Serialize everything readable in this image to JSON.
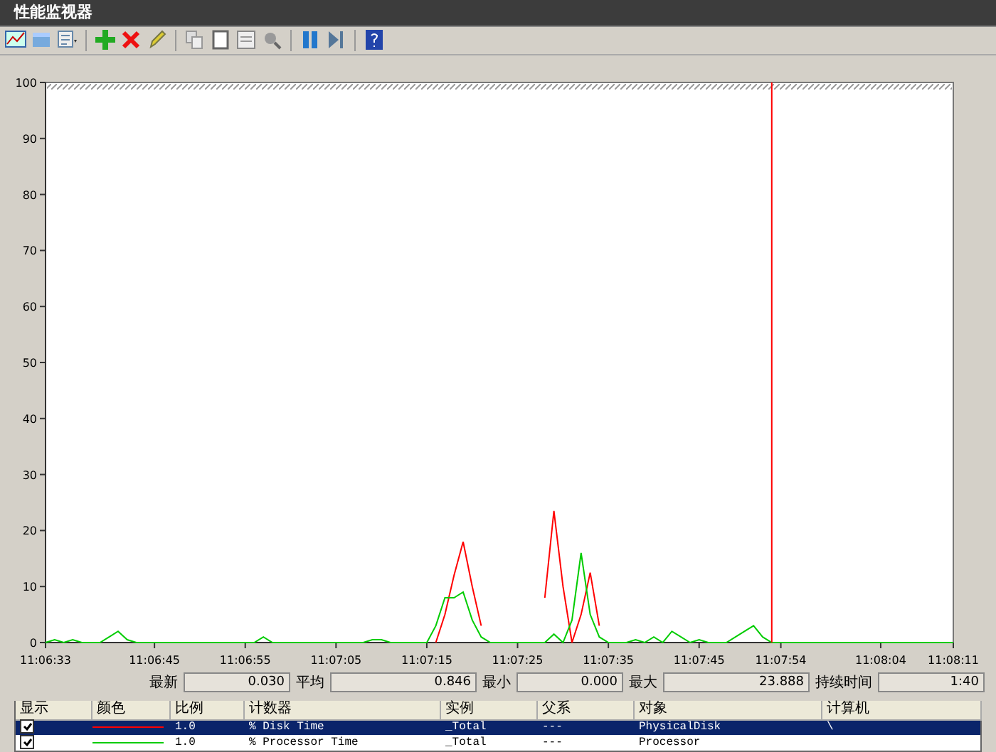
{
  "window": {
    "title": "性能监视器"
  },
  "chart": {
    "chart_data": {
      "type": "line",
      "ylim": [
        0,
        100
      ],
      "yticks": [
        0,
        10,
        20,
        30,
        40,
        50,
        60,
        70,
        80,
        90,
        100
      ],
      "categories": [
        "11:06:33",
        null,
        null,
        null,
        null,
        null,
        null,
        null,
        null,
        null,
        null,
        null,
        "11:06:45",
        null,
        null,
        null,
        null,
        null,
        null,
        null,
        null,
        null,
        "11:06:55",
        null,
        null,
        null,
        null,
        null,
        null,
        null,
        null,
        null,
        "11:07:05",
        null,
        null,
        null,
        null,
        null,
        null,
        null,
        null,
        null,
        "11:07:15",
        null,
        null,
        null,
        null,
        null,
        null,
        null,
        null,
        null,
        "11:07:25",
        null,
        null,
        null,
        null,
        null,
        null,
        null,
        null,
        null,
        "11:07:35",
        null,
        null,
        null,
        null,
        null,
        null,
        null,
        null,
        null,
        "11:07:45",
        null,
        null,
        null,
        null,
        null,
        null,
        null,
        null,
        "11:07:54",
        null,
        null,
        null,
        null,
        null,
        null,
        null,
        null,
        null,
        null,
        "11:08:04",
        null,
        null,
        null,
        null,
        null,
        null,
        null,
        "11:08:11"
      ],
      "series": [
        {
          "color": "#ff0000",
          "values": [
            null,
            null,
            null,
            null,
            null,
            null,
            null,
            null,
            null,
            null,
            null,
            null,
            null,
            null,
            null,
            null,
            null,
            null,
            null,
            null,
            null,
            null,
            null,
            null,
            null,
            null,
            null,
            null,
            null,
            null,
            null,
            null,
            null,
            null,
            null,
            null,
            null,
            null,
            null,
            null,
            null,
            null,
            null,
            0,
            5,
            12,
            18,
            10,
            3,
            null,
            null,
            null,
            null,
            null,
            null,
            8,
            23.5,
            10,
            0,
            5,
            12.5,
            3,
            null,
            null,
            null,
            null,
            null,
            null,
            null,
            null,
            null,
            null,
            null,
            null,
            null,
            null,
            null,
            null,
            null,
            null,
            null,
            null,
            null,
            null,
            null,
            null,
            null,
            null,
            null,
            null,
            null,
            null,
            null,
            null,
            null,
            null,
            null,
            null,
            null,
            null,
            null
          ]
        },
        {
          "color": "#00cc00",
          "values": [
            0,
            0.5,
            0,
            0.5,
            0,
            0,
            0,
            1,
            2,
            0.5,
            0,
            0,
            0,
            0,
            0,
            0,
            0,
            0,
            0,
            0,
            0,
            0,
            0,
            0,
            1,
            0,
            0,
            0,
            0,
            0,
            0,
            0,
            0,
            0,
            0,
            0,
            0.5,
            0.5,
            0,
            0,
            0,
            0,
            0,
            3,
            8,
            8,
            9,
            4,
            1,
            0,
            0,
            0,
            0,
            0,
            0,
            0,
            1.5,
            0,
            4,
            16,
            5,
            1,
            0,
            0,
            0,
            0.5,
            0,
            1,
            0,
            2,
            1,
            0,
            0.5,
            0,
            0,
            0,
            1,
            2,
            3,
            1,
            0,
            0,
            0,
            0,
            0,
            0,
            0,
            0,
            0,
            0,
            0,
            0,
            0,
            0,
            0,
            0,
            0,
            0,
            0,
            0,
            0
          ]
        }
      ]
    }
  },
  "stats": [
    {
      "label": "最新",
      "value": "0.030"
    },
    {
      "label": "平均",
      "value": "0.846"
    },
    {
      "label": "最小",
      "value": "0.000"
    },
    {
      "label": "最大",
      "value": "23.888"
    },
    {
      "label": "持续时间",
      "value": "1:40"
    }
  ],
  "table": {
    "columns": [
      "显示",
      "颜色",
      "比例",
      "计数器",
      "实例",
      "父系",
      "对象",
      "计算机"
    ],
    "rows": [
      {
        "checked": true,
        "selected": true,
        "color": "#ff0000",
        "scale": "1.0",
        "counter": "% Disk Time",
        "instance": "_Total",
        "parent": "---",
        "object": "PhysicalDisk",
        "computer": "\\"
      },
      {
        "checked": true,
        "selected": false,
        "color": "#00cc00",
        "scale": "1.0",
        "counter": "% Processor Time",
        "instance": "_Total",
        "parent": "---",
        "object": "Processor"
      }
    ]
  }
}
